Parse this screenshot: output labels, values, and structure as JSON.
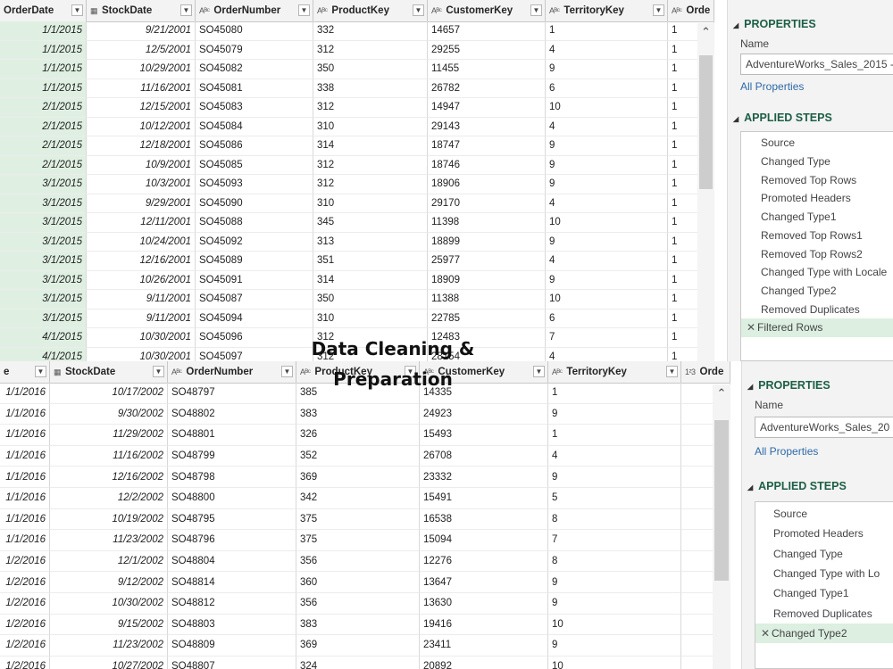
{
  "overlay_title": "Data Cleaning & Preparation",
  "top": {
    "columns": [
      {
        "label": "OrderDate",
        "type_icon": ""
      },
      {
        "label": "StockDate",
        "type_icon": "calendar"
      },
      {
        "label": "OrderNumber",
        "type_icon": "ABC"
      },
      {
        "label": "ProductKey",
        "type_icon": "ABC"
      },
      {
        "label": "CustomerKey",
        "type_icon": "ABC"
      },
      {
        "label": "TerritoryKey",
        "type_icon": "ABC"
      },
      {
        "label": "Orde",
        "type_icon": "ABC"
      }
    ],
    "rows": [
      [
        "1/1/2015",
        "9/21/2001",
        "SO45080",
        "332",
        "14657",
        "1",
        "1"
      ],
      [
        "1/1/2015",
        "12/5/2001",
        "SO45079",
        "312",
        "29255",
        "4",
        "1"
      ],
      [
        "1/1/2015",
        "10/29/2001",
        "SO45082",
        "350",
        "11455",
        "9",
        "1"
      ],
      [
        "1/1/2015",
        "11/16/2001",
        "SO45081",
        "338",
        "26782",
        "6",
        "1"
      ],
      [
        "2/1/2015",
        "12/15/2001",
        "SO45083",
        "312",
        "14947",
        "10",
        "1"
      ],
      [
        "2/1/2015",
        "10/12/2001",
        "SO45084",
        "310",
        "29143",
        "4",
        "1"
      ],
      [
        "2/1/2015",
        "12/18/2001",
        "SO45086",
        "314",
        "18747",
        "9",
        "1"
      ],
      [
        "2/1/2015",
        "10/9/2001",
        "SO45085",
        "312",
        "18746",
        "9",
        "1"
      ],
      [
        "3/1/2015",
        "10/3/2001",
        "SO45093",
        "312",
        "18906",
        "9",
        "1"
      ],
      [
        "3/1/2015",
        "9/29/2001",
        "SO45090",
        "310",
        "29170",
        "4",
        "1"
      ],
      [
        "3/1/2015",
        "12/11/2001",
        "SO45088",
        "345",
        "11398",
        "10",
        "1"
      ],
      [
        "3/1/2015",
        "10/24/2001",
        "SO45092",
        "313",
        "18899",
        "9",
        "1"
      ],
      [
        "3/1/2015",
        "12/16/2001",
        "SO45089",
        "351",
        "25977",
        "4",
        "1"
      ],
      [
        "3/1/2015",
        "10/26/2001",
        "SO45091",
        "314",
        "18909",
        "9",
        "1"
      ],
      [
        "3/1/2015",
        "9/11/2001",
        "SO45087",
        "350",
        "11388",
        "10",
        "1"
      ],
      [
        "3/1/2015",
        "9/11/2001",
        "SO45094",
        "310",
        "22785",
        "6",
        "1"
      ],
      [
        "4/1/2015",
        "10/30/2001",
        "SO45096",
        "312",
        "12483",
        "7",
        "1"
      ],
      [
        "4/1/2015",
        "10/30/2001",
        "SO45097",
        "312",
        "28154",
        "4",
        "1"
      ]
    ],
    "properties_label": "PROPERTIES",
    "name_label": "Name",
    "name_value": "AdventureWorks_Sales_2015 - A",
    "all_properties": "All Properties",
    "applied_steps_label": "APPLIED STEPS",
    "steps": [
      "Source",
      "Changed Type",
      "Removed Top Rows",
      "Promoted Headers",
      "Changed Type1",
      "Removed Top Rows1",
      "Removed Top Rows2",
      "Changed Type with Locale",
      "Changed Type2",
      "Removed Duplicates",
      "Filtered Rows"
    ],
    "selected_step": 10
  },
  "bottom": {
    "columns": [
      {
        "label": "e",
        "type_icon": ""
      },
      {
        "label": "StockDate",
        "type_icon": "calendar"
      },
      {
        "label": "OrderNumber",
        "type_icon": "ABC"
      },
      {
        "label": "ProductKey",
        "type_icon": "ABC"
      },
      {
        "label": "CustomerKey",
        "type_icon": "ABC"
      },
      {
        "label": "TerritoryKey",
        "type_icon": "ABC"
      },
      {
        "label": "Orde",
        "type_icon": "123"
      }
    ],
    "rows": [
      [
        "1/1/2016",
        "10/17/2002",
        "SO48797",
        "385",
        "14335",
        "1",
        ""
      ],
      [
        "1/1/2016",
        "9/30/2002",
        "SO48802",
        "383",
        "24923",
        "9",
        ""
      ],
      [
        "1/1/2016",
        "11/29/2002",
        "SO48801",
        "326",
        "15493",
        "1",
        ""
      ],
      [
        "1/1/2016",
        "11/16/2002",
        "SO48799",
        "352",
        "26708",
        "4",
        ""
      ],
      [
        "1/1/2016",
        "12/16/2002",
        "SO48798",
        "369",
        "23332",
        "9",
        ""
      ],
      [
        "1/1/2016",
        "12/2/2002",
        "SO48800",
        "342",
        "15491",
        "5",
        ""
      ],
      [
        "1/1/2016",
        "10/19/2002",
        "SO48795",
        "375",
        "16538",
        "8",
        ""
      ],
      [
        "1/1/2016",
        "11/23/2002",
        "SO48796",
        "375",
        "15094",
        "7",
        ""
      ],
      [
        "1/2/2016",
        "12/1/2002",
        "SO48804",
        "356",
        "12276",
        "8",
        ""
      ],
      [
        "1/2/2016",
        "9/12/2002",
        "SO48814",
        "360",
        "13647",
        "9",
        ""
      ],
      [
        "1/2/2016",
        "10/30/2002",
        "SO48812",
        "356",
        "13630",
        "9",
        ""
      ],
      [
        "1/2/2016",
        "9/15/2002",
        "SO48803",
        "383",
        "19416",
        "10",
        ""
      ],
      [
        "1/2/2016",
        "11/23/2002",
        "SO48809",
        "369",
        "23411",
        "9",
        ""
      ],
      [
        "1/2/2016",
        "10/27/2002",
        "SO48807",
        "324",
        "20892",
        "10",
        ""
      ]
    ],
    "properties_label": "PROPERTIES",
    "name_label": "Name",
    "name_value": "AdventureWorks_Sales_20",
    "all_properties": "All Properties",
    "applied_steps_label": "APPLIED STEPS",
    "steps": [
      "Source",
      "Promoted Headers",
      "Changed Type",
      "Changed Type with Lo",
      "Changed Type1",
      "Removed Duplicates",
      "Changed Type2"
    ],
    "selected_step": 6
  }
}
